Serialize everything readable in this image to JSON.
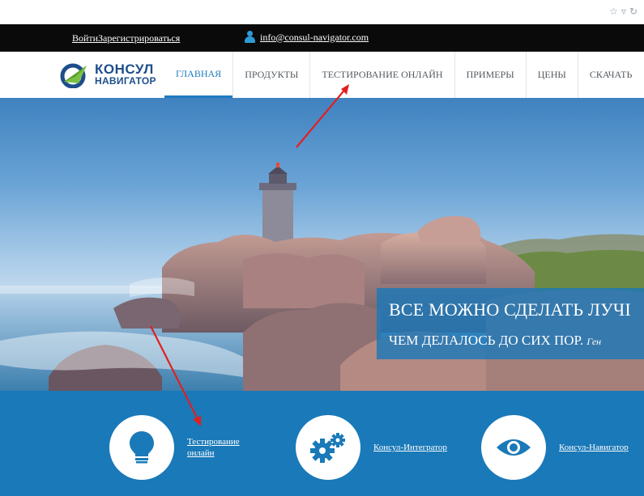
{
  "browser": {
    "icons": [
      "star-icon",
      "dropdown-icon",
      "reload-icon"
    ]
  },
  "topbar": {
    "login": "Войти",
    "register": "Зарегистрироваться",
    "email": "info@consul-navigator.com"
  },
  "logo": {
    "line1": "КОНСУЛ",
    "line2": "НАВИГАТОР"
  },
  "nav": {
    "items": [
      {
        "label": "ГЛАВНАЯ",
        "active": true
      },
      {
        "label": "ПРОДУКТЫ",
        "active": false
      },
      {
        "label": "ТЕСТИРОВАНИЕ ОНЛАЙН",
        "active": false
      },
      {
        "label": "ПРИМЕРЫ",
        "active": false
      },
      {
        "label": "ЦЕНЫ",
        "active": false
      },
      {
        "label": "СКАЧАТЬ",
        "active": false
      }
    ]
  },
  "hero": {
    "line1": "ВСЕ МОЖНО СДЕЛАТЬ ЛУЧІ",
    "line2": "ЧЕМ ДЕЛАЛОСЬ ДО СИХ ПОР.",
    "author": "Ген"
  },
  "features": [
    {
      "icon": "lightbulb-icon",
      "line1": "Тестирование",
      "line2": "онлайн"
    },
    {
      "icon": "gears-icon",
      "line1": "Консул-Интегратор",
      "line2": ""
    },
    {
      "icon": "eye-icon",
      "line1": "Консул-Навигатор",
      "line2": ""
    }
  ],
  "colors": {
    "accent": "#1e7bbf",
    "feature_band": "#1a79b8",
    "topbar": "#0a0a0a",
    "annotation_arrow": "#e02020"
  }
}
